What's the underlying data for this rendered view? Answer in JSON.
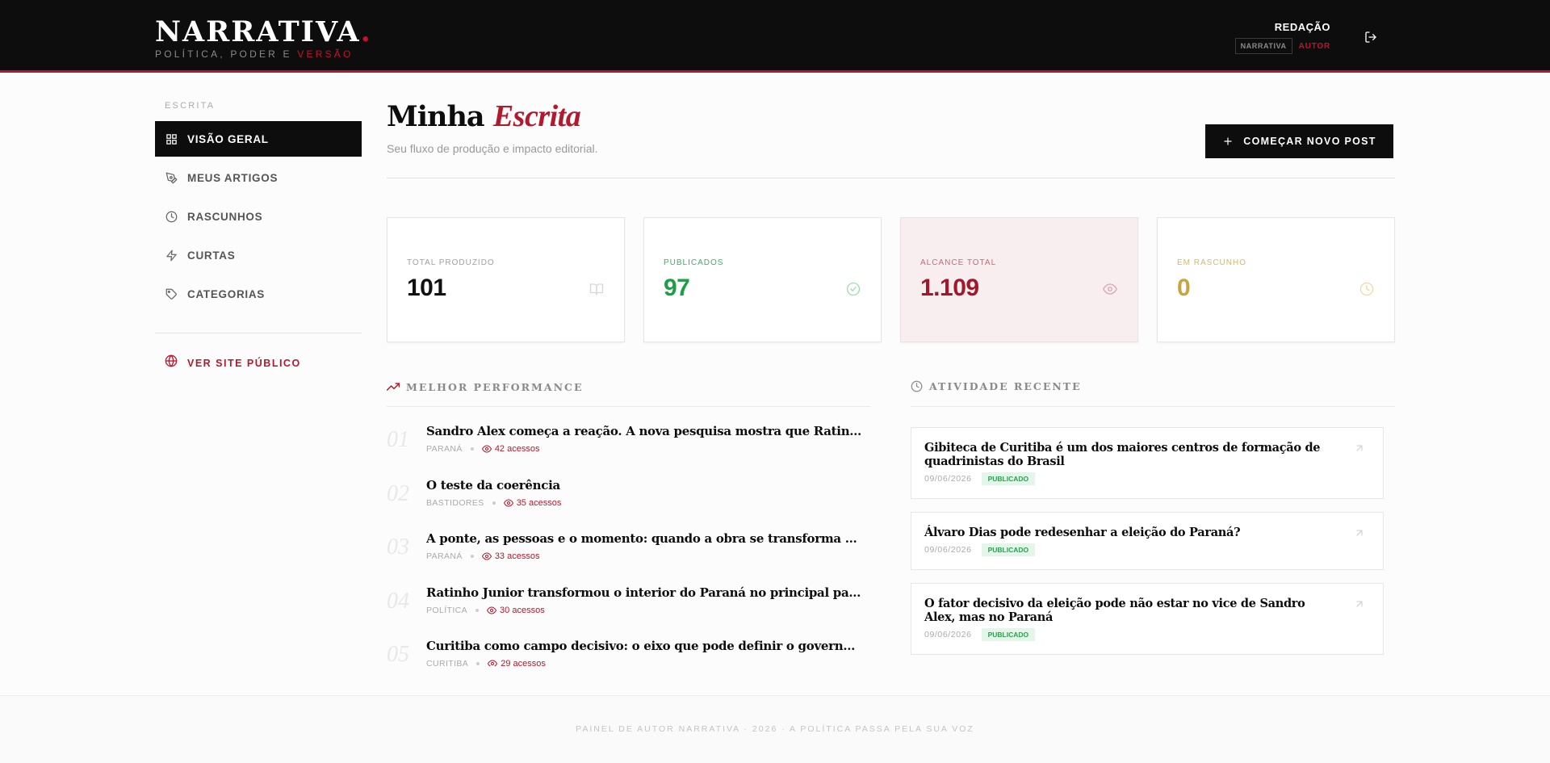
{
  "header": {
    "brand_name": "NARRATIVA",
    "brand_dot": ".",
    "brand_sub_prefix": "POLÍTICA, PODER E ",
    "brand_sub_accent": "VERSÃO",
    "user_name": "REDAÇÃO",
    "user_tag": "NARRATIVA",
    "user_role": "AUTOR",
    "logout_icon": "logout-icon"
  },
  "sidebar": {
    "section_label": "ESCRITA",
    "items": [
      {
        "label": "VISÃO GERAL",
        "icon": "grid-icon",
        "active": true
      },
      {
        "label": "MEUS ARTIGOS",
        "icon": "pen-icon",
        "active": false
      },
      {
        "label": "RASCUNHOS",
        "icon": "clock-icon",
        "active": false
      },
      {
        "label": "CURTAS",
        "icon": "bolt-icon",
        "active": false
      },
      {
        "label": "CATEGORIAS",
        "icon": "tag-icon",
        "active": false
      }
    ],
    "site_link": "VER SITE PÚBLICO"
  },
  "main": {
    "title_primary": "Minha",
    "title_accent": "Escrita",
    "subtitle": "Seu fluxo de produção e impacto editorial.",
    "new_post_label": "COMEÇAR NOVO POST"
  },
  "stats": [
    {
      "label": "TOTAL PRODUZIDO",
      "value": "101",
      "color": "#111111",
      "label_color": "#a0a0a0",
      "icon": "book-icon"
    },
    {
      "label": "PUBLICADOS",
      "value": "97",
      "color": "#1e9e47",
      "label_color": "#3fae63",
      "icon": "check-circle-icon"
    },
    {
      "label": "ALCANCE TOTAL",
      "value": "1.109",
      "color": "#a3172b",
      "label_color": "#c46b78",
      "icon": "eye-icon"
    },
    {
      "label": "EM RASCUNHO",
      "value": "0",
      "color": "#c9a341",
      "label_color": "#d4b870",
      "icon": "clock-icon"
    }
  ],
  "best_performance": {
    "title": "MELHOR PERFORMANCE",
    "items": [
      {
        "num": "01",
        "title": "Sandro Alex começa a reação. A nova pesquisa mostra que Ratinho...",
        "category": "PARANÁ",
        "views": "42 acessos"
      },
      {
        "num": "02",
        "title": "O teste da coerência",
        "category": "BASTIDORES",
        "views": "35 acessos"
      },
      {
        "num": "03",
        "title": "A ponte, as pessoas e o momento: quando a obra se transforma em...",
        "category": "PARANÁ",
        "views": "33 acessos"
      },
      {
        "num": "04",
        "title": "Ratinho Junior transformou o interior do Paraná no principal palco...",
        "category": "POLÍTICA",
        "views": "30 acessos"
      },
      {
        "num": "05",
        "title": "Curitiba como campo decisivo: o eixo que pode definir o governo do...",
        "category": "CURITIBA",
        "views": "29 acessos"
      }
    ]
  },
  "recent_activity": {
    "title": "ATIVIDADE RECENTE",
    "items": [
      {
        "title": "Gibiteca de Curitiba é um dos maiores centros de formação de quadrinistas do Brasil",
        "date": "09/06/2026",
        "status": "PUBLICADO"
      },
      {
        "title": "Álvaro Dias pode redesenhar a eleição do Paraná?",
        "date": "09/06/2026",
        "status": "PUBLICADO"
      },
      {
        "title": "O fator decisivo da eleição pode não estar no vice de Sandro Alex, mas no Paraná",
        "date": "09/06/2026",
        "status": "PUBLICADO"
      }
    ]
  },
  "footer": {
    "text": "PAINEL DE AUTOR NARRATIVA · 2026 · A POLÍTICA PASSA PELA SUA VOZ"
  },
  "colors": {
    "accent": "#b3182c",
    "dark": "#0d0d0d"
  }
}
